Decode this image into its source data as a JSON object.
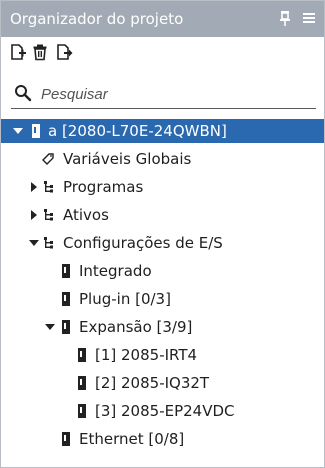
{
  "panel": {
    "title": "Organizador do projeto"
  },
  "search": {
    "placeholder": "Pesquisar"
  },
  "tree": {
    "root": {
      "label": "a [2080-L70E-24QWBN]"
    },
    "globals": {
      "label": "Variáveis Globais"
    },
    "programs": {
      "label": "Programas"
    },
    "assets": {
      "label": "Ativos"
    },
    "io": {
      "label": "Configurações de E/S"
    },
    "builtin": {
      "label": "Integrado"
    },
    "plugin": {
      "label": "Plug-in [0/3]"
    },
    "expansion": {
      "label": "Expansão [3/9]"
    },
    "exp1": {
      "label": "[1] 2085-IRT4"
    },
    "exp2": {
      "label": "[2] 2085-IQ32T"
    },
    "exp3": {
      "label": "[3] 2085-EP24VDC"
    },
    "ethernet": {
      "label": "Ethernet [0/8]"
    }
  },
  "colors": {
    "titlebar": "#a2abb5",
    "selection": "#2a69b0",
    "icon": "#222222"
  },
  "icons": {
    "pin": "pin-icon",
    "menu": "menu-icon",
    "add": "add-item-icon",
    "delete": "trash-icon",
    "export": "export-icon",
    "search": "search-icon",
    "device": "device-icon",
    "tag": "tag-icon",
    "tree": "tree-icon"
  }
}
